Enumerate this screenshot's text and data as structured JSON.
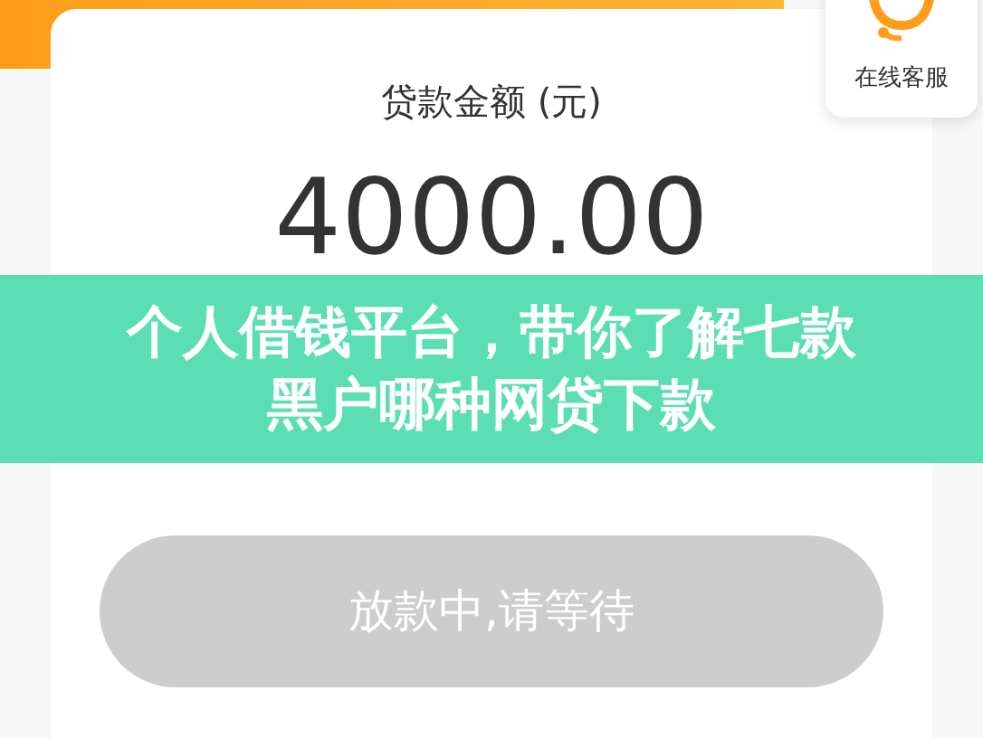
{
  "loan_card": {
    "label": "贷款金额 (元)",
    "amount": "4000.00"
  },
  "service": {
    "label": "在线客服"
  },
  "banner": {
    "title": "个人借钱平台，带你了解七款黑户哪种网贷下款"
  },
  "action_button": {
    "label": "放款中,请等待",
    "disabled": true
  }
}
